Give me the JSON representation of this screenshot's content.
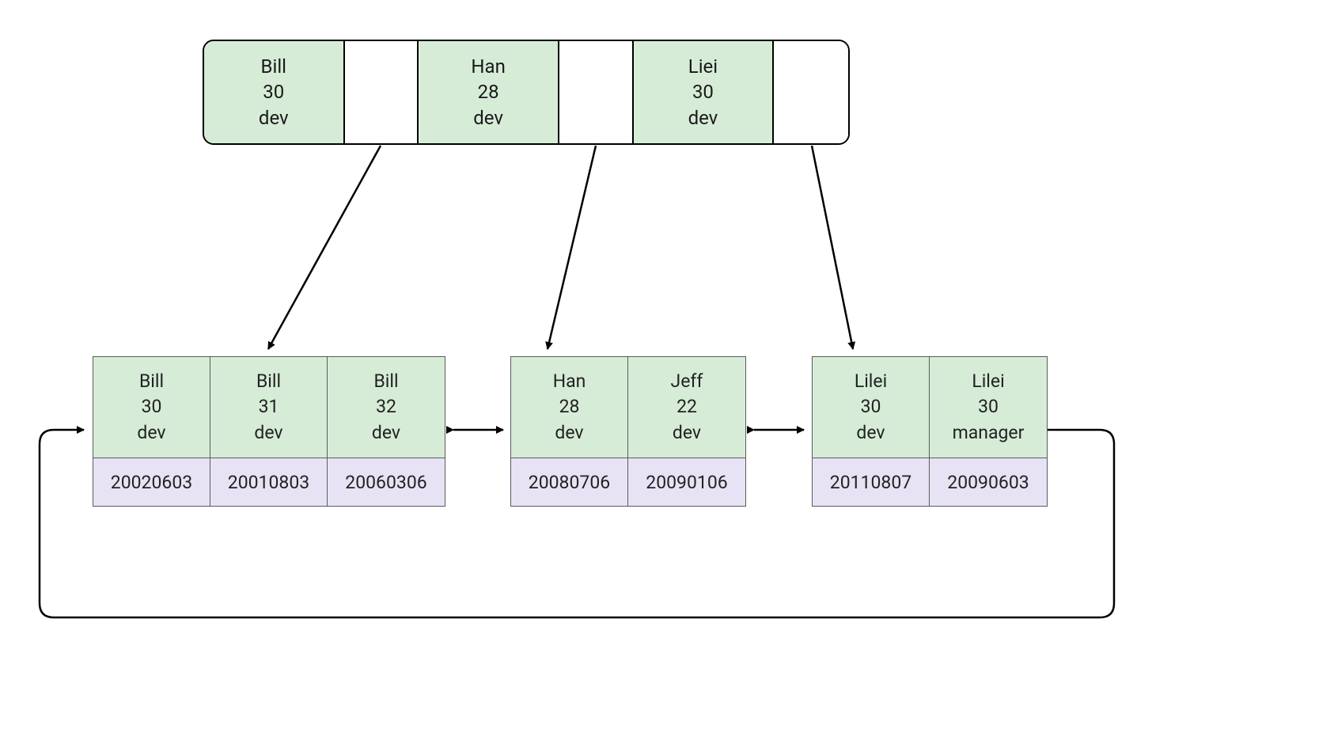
{
  "colors": {
    "keyFill": "#d6ecd7",
    "valueFill": "#e8e3f4",
    "stroke": "#000000"
  },
  "topNode": {
    "slots": [
      {
        "type": "key",
        "name": "Bill",
        "age": "30",
        "role": "dev"
      },
      {
        "type": "ptr"
      },
      {
        "type": "key",
        "name": "Han",
        "age": "28",
        "role": "dev"
      },
      {
        "type": "ptr"
      },
      {
        "type": "key",
        "name": "Liei",
        "age": "30",
        "role": "dev"
      },
      {
        "type": "ptr"
      }
    ]
  },
  "leaves": [
    {
      "entries": [
        {
          "name": "Bill",
          "age": "30",
          "role": "dev",
          "value": "20020603"
        },
        {
          "name": "Bill",
          "age": "31",
          "role": "dev",
          "value": "20010803"
        },
        {
          "name": "Bill",
          "age": "32",
          "role": "dev",
          "value": "20060306"
        }
      ]
    },
    {
      "entries": [
        {
          "name": "Han",
          "age": "28",
          "role": "dev",
          "value": "20080706"
        },
        {
          "name": "Jeff",
          "age": "22",
          "role": "dev",
          "value": "20090106"
        }
      ]
    },
    {
      "entries": [
        {
          "name": "Lilei",
          "age": "30",
          "role": "dev",
          "value": "20110807"
        },
        {
          "name": "Lilei",
          "age": "30",
          "role": "manager",
          "value": "20090603"
        }
      ]
    }
  ]
}
